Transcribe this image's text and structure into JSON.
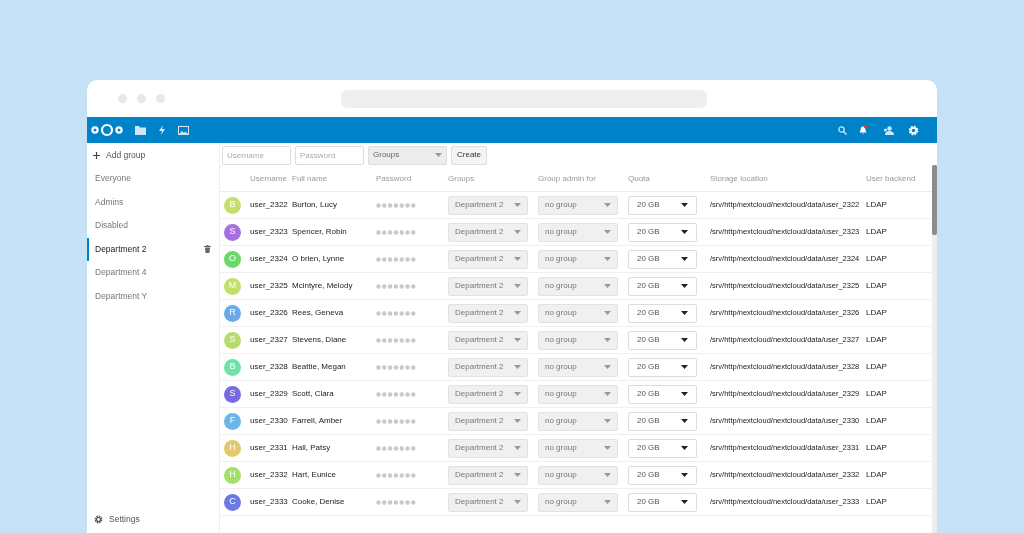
{
  "sidebar": {
    "add_group": "Add group",
    "items": [
      {
        "label": "Everyone",
        "selected": false
      },
      {
        "label": "Admins",
        "selected": false
      },
      {
        "label": "Disabled",
        "selected": false
      },
      {
        "label": "Department 2",
        "selected": true
      },
      {
        "label": "Department 4",
        "selected": false
      },
      {
        "label": "Department Y",
        "selected": false
      }
    ],
    "settings": "Settings"
  },
  "new_user": {
    "username_placeholder": "Username",
    "password_placeholder": "Password",
    "groups_placeholder": "Groups",
    "create": "Create"
  },
  "table": {
    "columns": [
      "Username",
      "Full name",
      "Password",
      "Groups",
      "Group admin for",
      "Quota",
      "Storage location",
      "User backend"
    ],
    "rows": [
      {
        "initial": "B",
        "color": "#c6df6b",
        "username": "user_2322",
        "full_name": "Burton, Lucy",
        "groups": "Department 2",
        "group_admin": "no group",
        "quota": "20 GB",
        "storage": "/srv/http/nextcloud/nextcloud/data/user_2322",
        "backend": "LDAP"
      },
      {
        "initial": "S",
        "color": "#a86ee2",
        "username": "user_2323",
        "full_name": "Spencer, Robin",
        "groups": "Department 2",
        "group_admin": "no group",
        "quota": "20 GB",
        "storage": "/srv/http/nextcloud/nextcloud/data/user_2323",
        "backend": "LDAP"
      },
      {
        "initial": "O",
        "color": "#6cd86c",
        "username": "user_2324",
        "full_name": "O brien, Lynne",
        "groups": "Department 2",
        "group_admin": "no group",
        "quota": "20 GB",
        "storage": "/srv/http/nextcloud/nextcloud/data/user_2324",
        "backend": "LDAP"
      },
      {
        "initial": "M",
        "color": "#c4de6a",
        "username": "user_2325",
        "full_name": "Mcintyre, Melody",
        "groups": "Department 2",
        "group_admin": "no group",
        "quota": "20 GB",
        "storage": "/srv/http/nextcloud/nextcloud/data/user_2325",
        "backend": "LDAP"
      },
      {
        "initial": "R",
        "color": "#6aaae8",
        "username": "user_2326",
        "full_name": "Rees, Geneva",
        "groups": "Department 2",
        "group_admin": "no group",
        "quota": "20 GB",
        "storage": "/srv/http/nextcloud/nextcloud/data/user_2326",
        "backend": "LDAP"
      },
      {
        "initial": "S",
        "color": "#b6dc6e",
        "username": "user_2327",
        "full_name": "Stevens, Diane",
        "groups": "Department 2",
        "group_admin": "no group",
        "quota": "20 GB",
        "storage": "/srv/http/nextcloud/nextcloud/data/user_2327",
        "backend": "LDAP"
      },
      {
        "initial": "B",
        "color": "#6ee2a8",
        "username": "user_2328",
        "full_name": "Beattie, Megan",
        "groups": "Department 2",
        "group_admin": "no group",
        "quota": "20 GB",
        "storage": "/srv/http/nextcloud/nextcloud/data/user_2328",
        "backend": "LDAP"
      },
      {
        "initial": "S",
        "color": "#786ae0",
        "username": "user_2329",
        "full_name": "Scott, Clara",
        "groups": "Department 2",
        "group_admin": "no group",
        "quota": "20 GB",
        "storage": "/srv/http/nextcloud/nextcloud/data/user_2329",
        "backend": "LDAP"
      },
      {
        "initial": "F",
        "color": "#6ab6ea",
        "username": "user_2330",
        "full_name": "Farrell, Amber",
        "groups": "Department 2",
        "group_admin": "no group",
        "quota": "20 GB",
        "storage": "/srv/http/nextcloud/nextcloud/data/user_2330",
        "backend": "LDAP"
      },
      {
        "initial": "H",
        "color": "#e6c86a",
        "username": "user_2331",
        "full_name": "Hall, Patsy",
        "groups": "Department 2",
        "group_admin": "no group",
        "quota": "20 GB",
        "storage": "/srv/http/nextcloud/nextcloud/data/user_2331",
        "backend": "LDAP"
      },
      {
        "initial": "H",
        "color": "#a2e06a",
        "username": "user_2332",
        "full_name": "Hart, Eunice",
        "groups": "Department 2",
        "group_admin": "no group",
        "quota": "20 GB",
        "storage": "/srv/http/nextcloud/nextcloud/data/user_2332",
        "backend": "LDAP"
      },
      {
        "initial": "C",
        "color": "#6a7ae6",
        "username": "user_2333",
        "full_name": "Cooke, Denise",
        "groups": "Department 2",
        "group_admin": "no group",
        "quota": "20 GB",
        "storage": "/srv/http/nextcloud/nextcloud/data/user_2333",
        "backend": "LDAP"
      }
    ]
  }
}
